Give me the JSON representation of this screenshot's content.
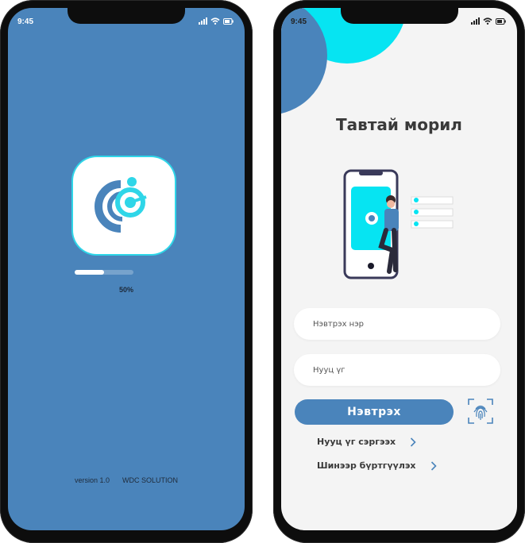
{
  "status_bar": {
    "time": "9:45"
  },
  "splash": {
    "progress_label": "50%",
    "progress_fraction": 0.5,
    "version": "version 1.0",
    "company": "WDC SOLUTION"
  },
  "login": {
    "title": "Тавтай морил",
    "username_placeholder": "Нэвтрэх нэр",
    "password_placeholder": "Нууц үг",
    "login_button": "Нэвтрэх",
    "forgot_password": "Нууц үг сэргээх",
    "register": "Шинээр бүртгүүлэх"
  },
  "colors": {
    "primary": "#4a84bb",
    "accent": "#06e4f2",
    "background": "#f4f4f4"
  },
  "icons": [
    "signal-icon",
    "wifi-icon",
    "battery-icon",
    "fingerprint-icon",
    "chevron-right-icon",
    "app-logo"
  ]
}
